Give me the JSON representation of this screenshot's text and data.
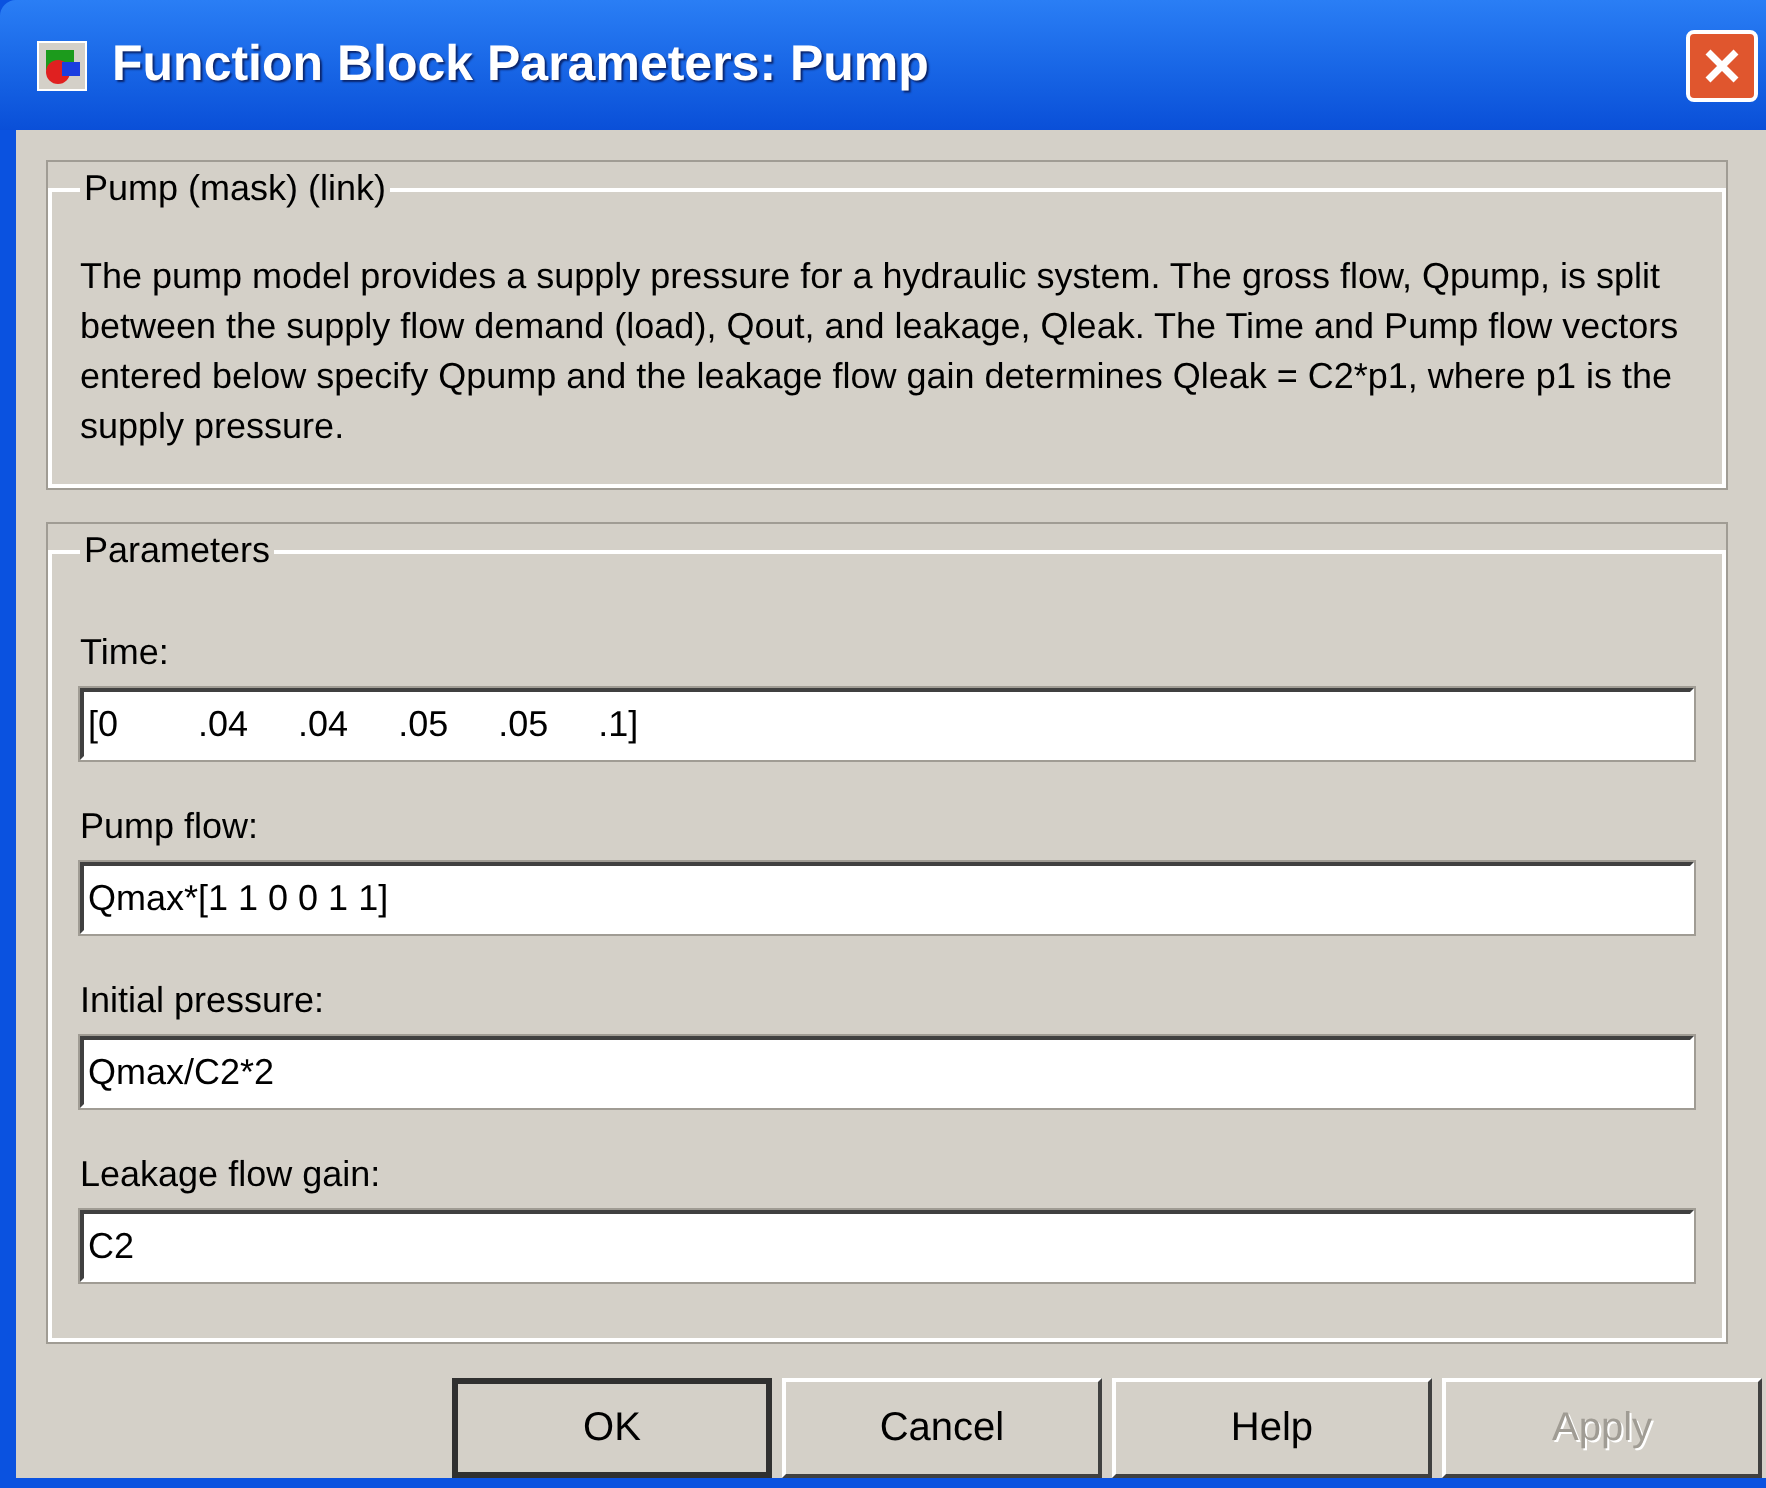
{
  "window": {
    "title": "Function Block Parameters: Pump"
  },
  "description_group": {
    "title": "Pump (mask) (link)",
    "text": "The pump model provides a supply pressure for a hydraulic system.  The gross flow, Qpump, is split between the supply flow demand (load), Qout, and leakage, Qleak. The Time and Pump flow vectors entered below specify Qpump and the leakage flow gain determines Qleak = C2*p1, where p1 is the supply pressure."
  },
  "parameters": {
    "title": "Parameters",
    "fields": [
      {
        "label": "Time:",
        "value": "[0        .04     .04     .05     .05     .1]"
      },
      {
        "label": "Pump flow:",
        "value": "Qmax*[1 1 0 0 1 1]"
      },
      {
        "label": "Initial pressure:",
        "value": "Qmax/C2*2"
      },
      {
        "label": "Leakage flow gain:",
        "value": "C2"
      }
    ]
  },
  "buttons": [
    {
      "label": "OK",
      "default": true,
      "disabled": false
    },
    {
      "label": "Cancel",
      "default": false,
      "disabled": false
    },
    {
      "label": "Help",
      "default": false,
      "disabled": false
    },
    {
      "label": "Apply",
      "default": false,
      "disabled": true
    }
  ]
}
